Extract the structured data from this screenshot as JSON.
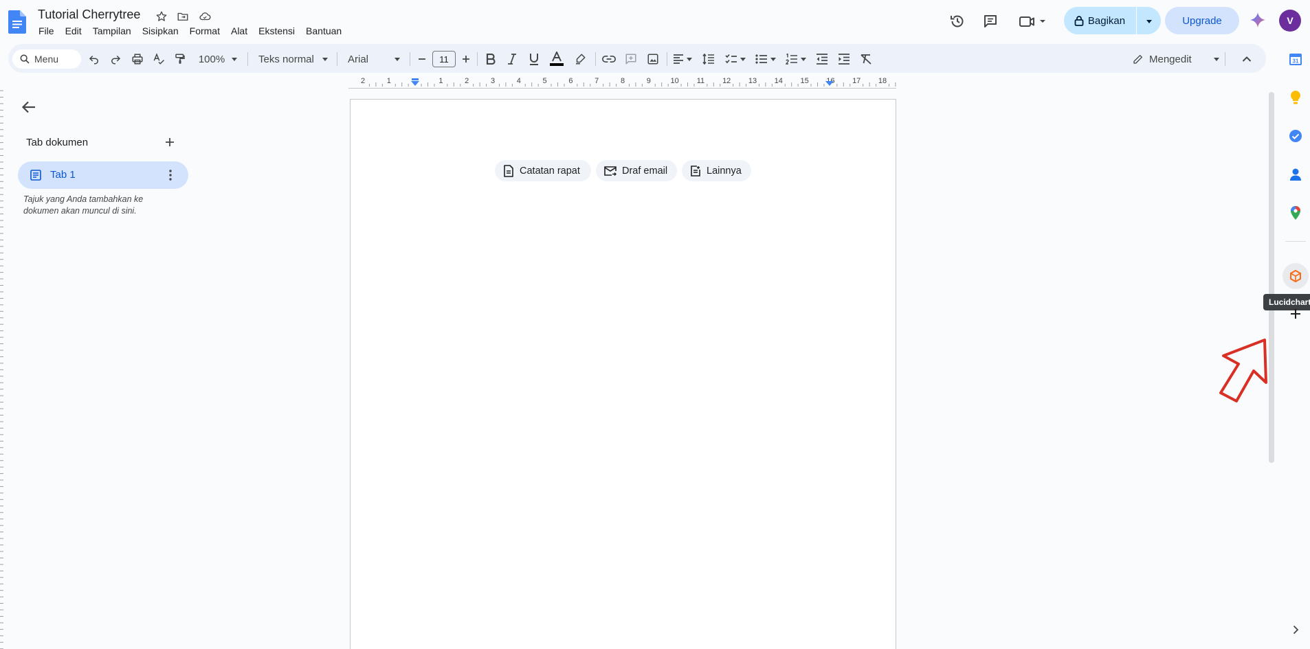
{
  "app": {
    "title": "Tutorial Cherrytree",
    "menu": [
      "File",
      "Edit",
      "Tampilan",
      "Sisipkan",
      "Format",
      "Alat",
      "Ekstensi",
      "Bantuan"
    ],
    "share_label": "Bagikan",
    "upgrade_label": "Upgrade",
    "avatar_initial": "V",
    "accent_color": "#0b57d0"
  },
  "toolbar": {
    "menu_search": "Menu",
    "zoom": "100%",
    "style": "Teks normal",
    "font": "Arial",
    "font_size": "11",
    "mode": "Mengedit",
    "text_color": "#000000"
  },
  "sidebar": {
    "title": "Tab dokumen",
    "tab_label": "Tab 1",
    "hint": "Tajuk yang Anda tambahkan ke dokumen akan muncul di sini."
  },
  "ruler": {
    "labels": [
      "2",
      "1",
      "",
      "1",
      "2",
      "3",
      "4",
      "5",
      "6",
      "7",
      "8",
      "9",
      "10",
      "11",
      "12",
      "13",
      "14",
      "15",
      "16",
      "17",
      "18"
    ]
  },
  "document": {
    "chips": [
      {
        "label": "Catatan rapat",
        "icon": "document-icon"
      },
      {
        "label": "Draf email",
        "icon": "mail-icon"
      },
      {
        "label": "Lainnya",
        "icon": "add-note-icon"
      }
    ]
  },
  "side_panel": {
    "tooltip": "Lucidchart",
    "icons": [
      "calendar-icon",
      "keep-icon",
      "tasks-icon",
      "contacts-icon",
      "maps-icon",
      "lucidchart-icon",
      "add-icon"
    ]
  },
  "annotation": {
    "color": "#d93025"
  }
}
